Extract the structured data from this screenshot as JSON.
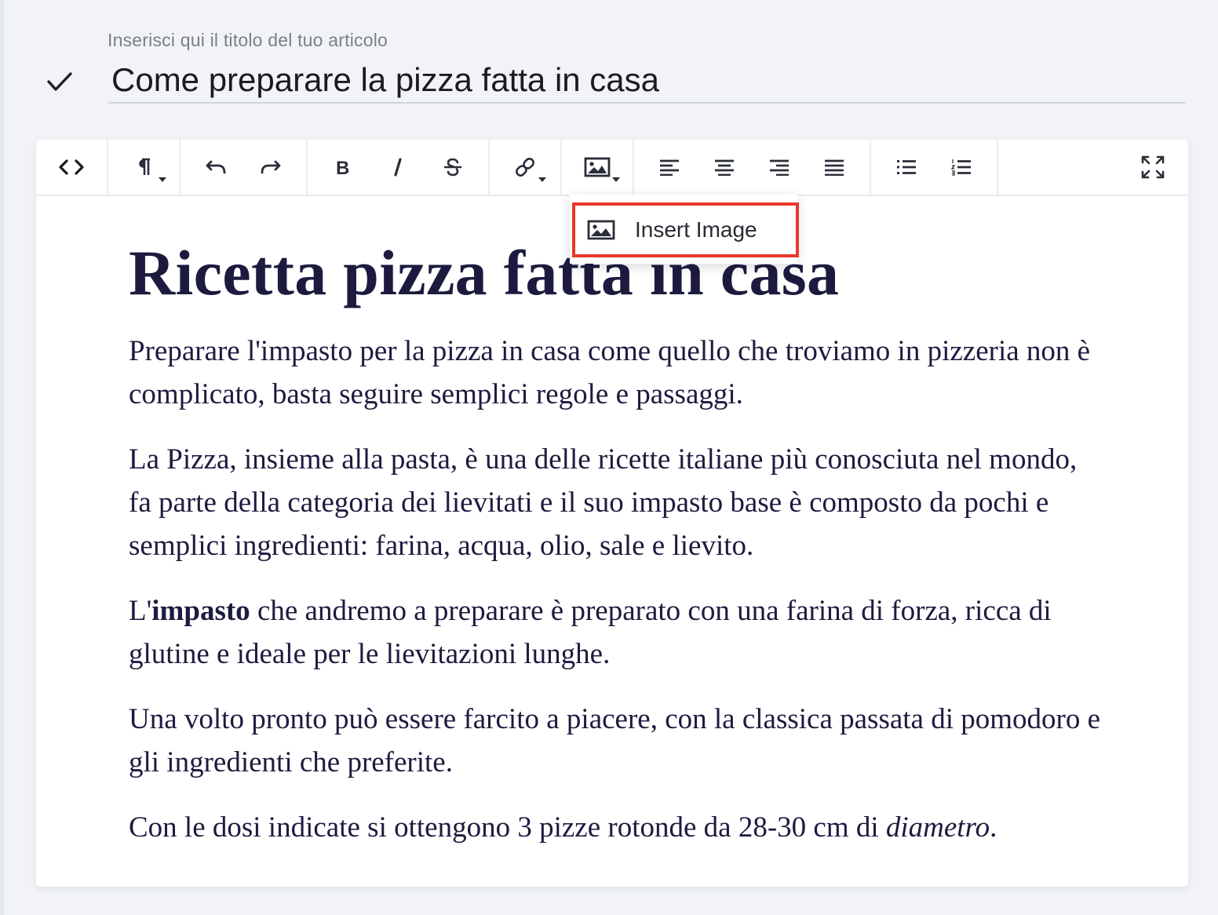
{
  "title": {
    "placeholder": "Inserisci qui il titolo del tuo articolo",
    "value": "Come preparare la pizza fatta in casa"
  },
  "toolbar": {
    "buttons": [
      {
        "name": "code-view",
        "icon": "code-icon"
      },
      {
        "name": "paragraph-format",
        "icon": "paragraph-icon"
      },
      {
        "name": "undo",
        "icon": "undo-icon"
      },
      {
        "name": "redo",
        "icon": "redo-icon"
      },
      {
        "name": "bold",
        "icon": "bold-icon"
      },
      {
        "name": "italic",
        "icon": "italic-icon"
      },
      {
        "name": "strikethrough",
        "icon": "strikethrough-icon"
      },
      {
        "name": "link",
        "icon": "link-icon"
      },
      {
        "name": "image",
        "icon": "image-icon"
      },
      {
        "name": "align-left",
        "icon": "align-left-icon"
      },
      {
        "name": "align-center",
        "icon": "align-center-icon"
      },
      {
        "name": "align-right",
        "icon": "align-right-icon"
      },
      {
        "name": "align-justify",
        "icon": "align-justify-icon"
      },
      {
        "name": "bulleted-list",
        "icon": "bulleted-list-icon"
      },
      {
        "name": "numbered-list",
        "icon": "numbered-list-icon"
      },
      {
        "name": "fullscreen",
        "icon": "fullscreen-icon"
      }
    ],
    "image_dropdown": {
      "items": [
        {
          "label": "Insert Image",
          "icon": "image-icon"
        }
      ]
    }
  },
  "article": {
    "heading": "Ricetta pizza fatta in casa",
    "p1": "Preparare l'impasto per la pizza in casa come quello che troviamo in pizzeria non è complicato, basta seguire semplici regole e passaggi.",
    "p2": "La Pizza, insieme alla pasta, è una delle ricette italiane più conosciuta nel mondo, fa parte della categoria dei lievitati e il suo impasto base è composto da pochi e semplici ingredienti: farina, acqua, olio, sale e lievito.",
    "p3_prefix": "L'",
    "p3_bold": "impasto",
    "p3_rest": " che andremo a preparare è preparato con una farina di forza, ricca di glutine e ideale per le lievitazioni lunghe.",
    "p4": "Una volto pronto può essere farcito a piacere, con la classica passata di pomodoro e gli ingredienti che preferite.",
    "p5_prefix": "Con le dosi indicate si ottengono 3 pizze rotonde da 28-30 cm di ",
    "p5_italic": "diametro",
    "p5_suffix": "."
  },
  "colors": {
    "highlight_border": "#e8382a",
    "text": "#1c1b3f",
    "background": "#f1f3f7"
  }
}
